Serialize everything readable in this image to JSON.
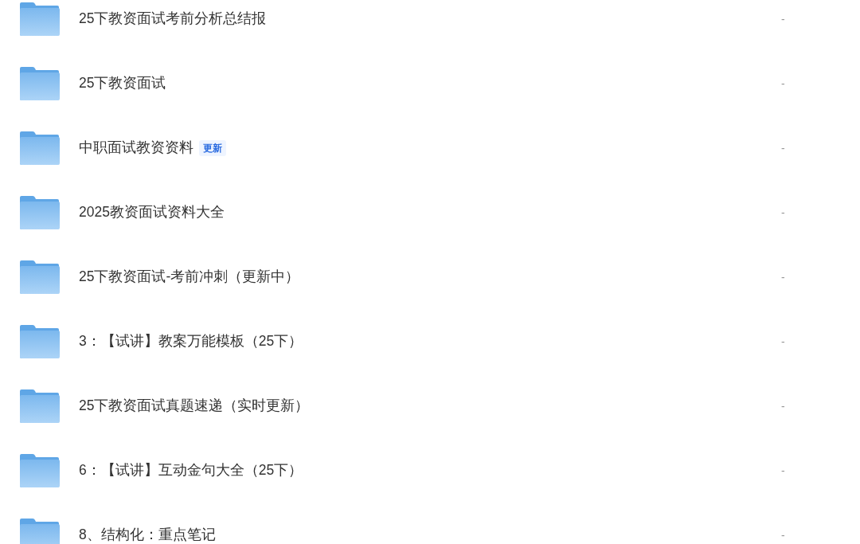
{
  "files": [
    {
      "name": "25下教资面试考前分析总结报",
      "column_2": "-"
    },
    {
      "name": "25下教资面试",
      "column_2": "-"
    },
    {
      "name": "中职面试教资资料",
      "badge": "更新",
      "column_2": "-"
    },
    {
      "name": "2025教资面试资料大全",
      "column_2": "-"
    },
    {
      "name": "25下教资面试-考前冲刺（更新中）",
      "column_2": "-"
    },
    {
      "name": "3：【试讲】教案万能模板（25下）",
      "column_2": "-"
    },
    {
      "name": "25下教资面试真题速递（实时更新）",
      "column_2": "-"
    },
    {
      "name": "6：【试讲】互动金句大全（25下）",
      "column_2": "-"
    },
    {
      "name": "8、结构化：重点笔记",
      "column_2": "-"
    }
  ]
}
